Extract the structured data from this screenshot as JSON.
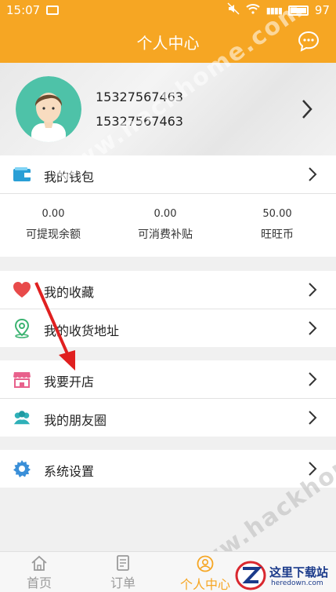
{
  "status_bar": {
    "time": "15:07",
    "battery": "97"
  },
  "header": {
    "title": "个人中心"
  },
  "profile": {
    "phone": "15327567463",
    "nickname": "15327567463"
  },
  "wallet": {
    "label": "我的钱包",
    "stats": [
      {
        "value": "0.00",
        "label": "可提现余额"
      },
      {
        "value": "0.00",
        "label": "可消费补贴"
      },
      {
        "value": "50.00",
        "label": "旺旺币"
      }
    ]
  },
  "menu": {
    "favorites": "我的收藏",
    "address": "我的收货地址",
    "open_store": "我要开店",
    "friends": "我的朋友圈",
    "settings": "系统设置"
  },
  "tabs": [
    {
      "label": "首页",
      "icon": "home-icon"
    },
    {
      "label": "订单",
      "icon": "order-icon"
    },
    {
      "label": "个人中心",
      "icon": "profile-icon",
      "active": true
    }
  ],
  "watermark": {
    "text": "www.hackhome.com",
    "brand_name": "这里下载站",
    "brand_url": "heredown.com"
  },
  "colors": {
    "accent": "#f6a623",
    "heart": "#e84a4a",
    "arrow": "#e02020",
    "settings_blue": "#3a8fd8"
  }
}
